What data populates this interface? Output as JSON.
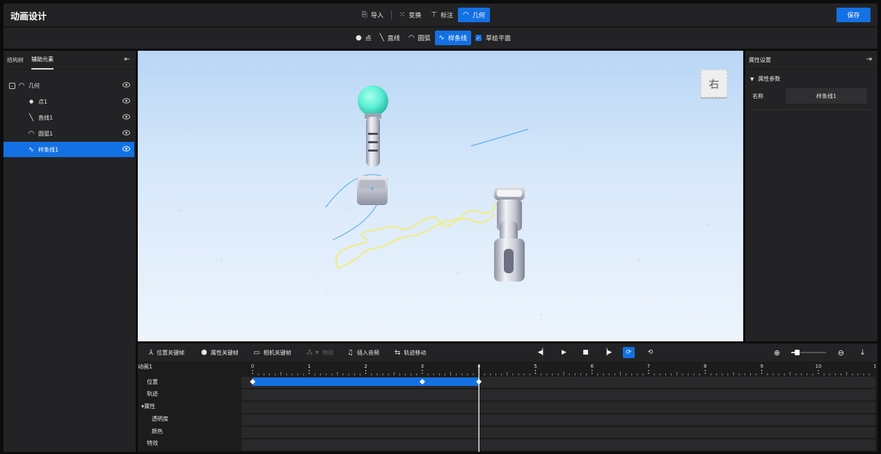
{
  "app": {
    "title": "动画设计",
    "save_label": "保存"
  },
  "top_tools": [
    {
      "label": "导入",
      "icon": "import-icon",
      "active": false
    },
    {
      "label": "变换",
      "icon": "transform-icon",
      "active": false
    },
    {
      "label": "标注",
      "icon": "annotation-icon",
      "active": false
    },
    {
      "label": "几何",
      "icon": "arc-icon",
      "active": true
    }
  ],
  "sub_tools": [
    {
      "label": "点",
      "icon": "dot-icon",
      "active": false
    },
    {
      "label": "直线",
      "icon": "line-icon",
      "active": false
    },
    {
      "label": "圆弧",
      "icon": "arc-icon",
      "active": false
    },
    {
      "label": "样条线",
      "icon": "spline-icon",
      "active": true
    }
  ],
  "sketch_plane": {
    "label": "草绘平面",
    "checked": true
  },
  "left_panel": {
    "tabs": [
      {
        "label": "结构树",
        "active": false
      },
      {
        "label": "辅助元素",
        "active": true
      }
    ],
    "tree": [
      {
        "label": "几何",
        "icon": "arc-icon",
        "level": 0,
        "expandable": true,
        "selected": false
      },
      {
        "label": "点1",
        "icon": "dot-icon",
        "level": 1,
        "expandable": false,
        "selected": false
      },
      {
        "label": "直线1",
        "icon": "line-icon",
        "level": 1,
        "expandable": false,
        "selected": false
      },
      {
        "label": "圆弧1",
        "icon": "arc-icon",
        "level": 1,
        "expandable": false,
        "selected": false
      },
      {
        "label": "样条线1",
        "icon": "spline-icon",
        "level": 1,
        "expandable": false,
        "selected": true
      }
    ]
  },
  "viewport": {
    "view_cube_label": "右"
  },
  "right_panel": {
    "title": "属性设置",
    "section_title": "属性参数",
    "name_label": "名称",
    "name_value": "样条线1"
  },
  "timeline": {
    "toolbar": [
      {
        "label": "位置关键帧",
        "icon": "position-keyframe-icon",
        "enabled": true
      },
      {
        "label": "属性关键帧",
        "icon": "cube-icon",
        "enabled": true
      },
      {
        "label": "相机关键帧",
        "icon": "camera-icon",
        "enabled": true
      },
      {
        "label": "特效",
        "icon": "effect-icon",
        "enabled": false
      },
      {
        "label": "插入音频",
        "icon": "audio-icon",
        "enabled": true
      },
      {
        "label": "轨迹移动",
        "icon": "track-move-icon",
        "enabled": true
      }
    ],
    "animation_name": "动画1",
    "tracks": [
      {
        "label": "位置",
        "indent": 1
      },
      {
        "label": "轨迹",
        "indent": 1
      },
      {
        "label": "属性",
        "indent": 0,
        "expanded": true
      },
      {
        "label": "透明度",
        "indent": 2
      },
      {
        "label": "颜色",
        "indent": 2
      },
      {
        "label": "特效",
        "indent": 1
      }
    ],
    "ruler": [
      "0",
      "1",
      "2",
      "3",
      "4",
      "5",
      "6",
      "7",
      "8",
      "9",
      "10",
      "1"
    ],
    "position_keyframes": [
      0,
      3,
      4
    ],
    "playhead_time": 4,
    "loop_enabled": true,
    "zoom_level": 0.1
  },
  "colors": {
    "accent": "#1471e3",
    "spline_yellow": "#f3ec6f",
    "spline_blue": "#5fb0e6",
    "sphere": "#5ff0d4"
  }
}
